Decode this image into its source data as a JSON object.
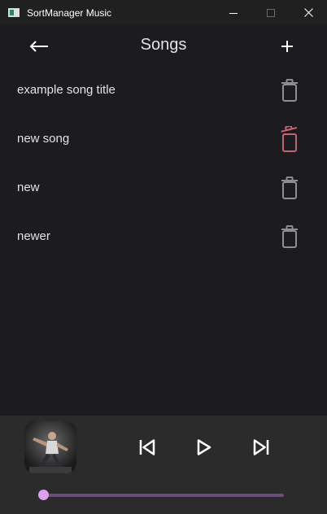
{
  "window": {
    "title": "SortManager Music",
    "icons": {
      "app": "app-icon",
      "minimize": "minimize-icon",
      "maximize": "maximize-icon",
      "close": "close-icon"
    }
  },
  "header": {
    "title": "Songs",
    "back_icon": "arrow-left-icon",
    "add_icon": "plus-icon"
  },
  "songs": [
    {
      "title": "example song title",
      "delete_icon": "trash-icon",
      "state": "normal"
    },
    {
      "title": "new song",
      "delete_icon": "trash-icon",
      "state": "hovered"
    },
    {
      "title": "new",
      "delete_icon": "trash-icon",
      "state": "normal"
    },
    {
      "title": "newer",
      "delete_icon": "trash-icon",
      "state": "normal"
    }
  ],
  "player": {
    "album_art": "album-cover-image",
    "controls": [
      "skip-previous-icon",
      "play-icon",
      "skip-next-icon"
    ],
    "progress_fraction": 0.0
  },
  "colors": {
    "background": "#1c1b1f",
    "player_background": "#2b2b2b",
    "trash_normal": "#8e8e8e",
    "trash_hovered": "#c1676f",
    "progress_track": "#6b4d79",
    "progress_thumb": "#dca0ee"
  }
}
